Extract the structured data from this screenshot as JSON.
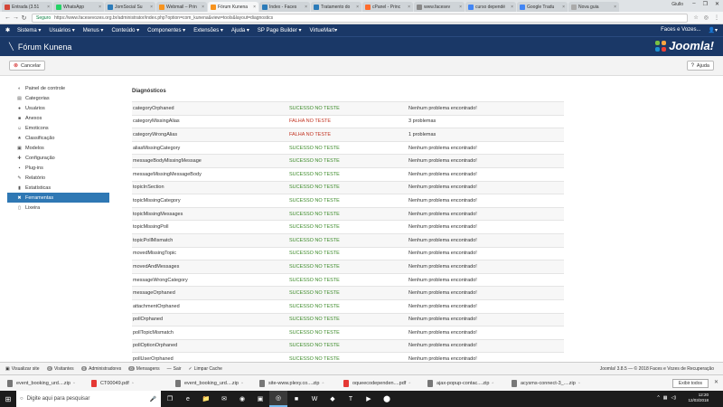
{
  "browser": {
    "tabs": [
      {
        "title": "Entrada (3.51",
        "color": "#d44638"
      },
      {
        "title": "WhatsApp",
        "color": "#25d366"
      },
      {
        "title": "JomSocial Su",
        "color": "#2b7bb9"
      },
      {
        "title": "Webmail – Prin",
        "color": "#f7931e"
      },
      {
        "title": "Fórum Kunena",
        "color": "#f7931e"
      },
      {
        "title": "Index - Faces",
        "color": "#2b7bb9"
      },
      {
        "title": "Tratamento do",
        "color": "#2b7bb9"
      },
      {
        "title": "cPanel - Princ",
        "color": "#ff6c2c"
      },
      {
        "title": "www.facesev",
        "color": "#888888"
      },
      {
        "title": "curso dependé",
        "color": "#4285f4"
      },
      {
        "title": "Google Tradu",
        "color": "#4285f4"
      },
      {
        "title": "Nova guia",
        "color": "#aaaaaa"
      }
    ],
    "active_tab": 4,
    "user": "Giullo",
    "secure_label": "Seguro",
    "url": "https://www.facesevozes.org.br/administrator/index.php?option=com_kunena&view=tools&layout=diagnostics"
  },
  "joomla_nav": {
    "menus": [
      "Sistema ▾",
      "Usuários ▾",
      "Menus ▾",
      "Conteúdo ▾",
      "Componentes ▾",
      "Extensões ▾",
      "Ajuda ▾",
      "SP Page Builder ▾",
      "VirtueMart▾"
    ],
    "site_name": "Faces e Vozes...",
    "user_menu": "▾"
  },
  "page": {
    "title": "Fórum Kunena",
    "logo_text": "Joomla!",
    "cancel_label": "Cancelar",
    "help_label": "Ajuda"
  },
  "sidebar": {
    "items": [
      {
        "label": "Painel de controle",
        "icon": "dashboard-icon",
        "glyph": "◐"
      },
      {
        "label": "Categorias",
        "icon": "categories-icon",
        "glyph": "▤"
      },
      {
        "label": "Usuários",
        "icon": "users-icon",
        "glyph": "●"
      },
      {
        "label": "Anexos",
        "icon": "attachments-icon",
        "glyph": "■"
      },
      {
        "label": "Emoticons",
        "icon": "emoticons-icon",
        "glyph": "☺"
      },
      {
        "label": "Classificação",
        "icon": "ranking-icon",
        "glyph": "★"
      },
      {
        "label": "Modelos",
        "icon": "templates-icon",
        "glyph": "▣"
      },
      {
        "label": "Configuração",
        "icon": "config-icon",
        "glyph": "✚"
      },
      {
        "label": "Plug-ins",
        "icon": "plugins-icon",
        "glyph": "▪"
      },
      {
        "label": "Relatório",
        "icon": "report-icon",
        "glyph": "✎"
      },
      {
        "label": "Estatísticas",
        "icon": "stats-icon",
        "glyph": "▮"
      },
      {
        "label": "Ferramentas",
        "icon": "tools-icon",
        "glyph": "✖"
      },
      {
        "label": "Lixeira",
        "icon": "trash-icon",
        "glyph": "▯"
      }
    ],
    "active_index": 11
  },
  "diagnostics": {
    "heading": "Diagnósticos",
    "rows": [
      {
        "name": "categoryOrphaned",
        "status": "SUCESSO NO TESTE",
        "ok": true,
        "result": "Nenhum problema encontrado!"
      },
      {
        "name": "categoryMissingAlias",
        "status": "FALHA NO TESTE",
        "ok": false,
        "result": "3 problemas"
      },
      {
        "name": "categoryWrongAlias",
        "status": "FALHA NO TESTE",
        "ok": false,
        "result": "1 problemas"
      },
      {
        "name": "aliasMissingCategory",
        "status": "SUCESSO NO TESTE",
        "ok": true,
        "result": "Nenhum problema encontrado!"
      },
      {
        "name": "messageBodyMissingMessage",
        "status": "SUCESSO NO TESTE",
        "ok": true,
        "result": "Nenhum problema encontrado!"
      },
      {
        "name": "messageMissingMessageBody",
        "status": "SUCESSO NO TESTE",
        "ok": true,
        "result": "Nenhum problema encontrado!"
      },
      {
        "name": "topicInSection",
        "status": "SUCESSO NO TESTE",
        "ok": true,
        "result": "Nenhum problema encontrado!"
      },
      {
        "name": "topicMissingCategory",
        "status": "SUCESSO NO TESTE",
        "ok": true,
        "result": "Nenhum problema encontrado!"
      },
      {
        "name": "topicMissingMessages",
        "status": "SUCESSO NO TESTE",
        "ok": true,
        "result": "Nenhum problema encontrado!"
      },
      {
        "name": "topicMissingPoll",
        "status": "SUCESSO NO TESTE",
        "ok": true,
        "result": "Nenhum problema encontrado!"
      },
      {
        "name": "topicPollMismatch",
        "status": "SUCESSO NO TESTE",
        "ok": true,
        "result": "Nenhum problema encontrado!"
      },
      {
        "name": "movedMissingTopic",
        "status": "SUCESSO NO TESTE",
        "ok": true,
        "result": "Nenhum problema encontrado!"
      },
      {
        "name": "movedAndMessages",
        "status": "SUCESSO NO TESTE",
        "ok": true,
        "result": "Nenhum problema encontrado!"
      },
      {
        "name": "messageWrongCategory",
        "status": "SUCESSO NO TESTE",
        "ok": true,
        "result": "Nenhum problema encontrado!"
      },
      {
        "name": "messageOrphaned",
        "status": "SUCESSO NO TESTE",
        "ok": true,
        "result": "Nenhum problema encontrado!"
      },
      {
        "name": "attachmentOrphaned",
        "status": "SUCESSO NO TESTE",
        "ok": true,
        "result": "Nenhum problema encontrado!"
      },
      {
        "name": "pollOrphaned",
        "status": "SUCESSO NO TESTE",
        "ok": true,
        "result": "Nenhum problema encontrado!"
      },
      {
        "name": "pollTopicMismatch",
        "status": "SUCESSO NO TESTE",
        "ok": true,
        "result": "Nenhum problema encontrado!"
      },
      {
        "name": "pollOptionOrphaned",
        "status": "SUCESSO NO TESTE",
        "ok": true,
        "result": "Nenhum problema encontrado!"
      },
      {
        "name": "pollUserOrphaned",
        "status": "SUCESSO NO TESTE",
        "ok": true,
        "result": "Nenhum problema encontrado!"
      }
    ]
  },
  "statusbar": {
    "view_site": "Visualizar site",
    "visitors_count": "0",
    "visitors_label": "Visitantes",
    "admins_count": "0",
    "admins_label": "Administradores",
    "messages_count": "0",
    "messages_label": "Mensagens",
    "logout": "Sair",
    "clear_cache": "Limpar Cache",
    "copyright": "Joomla! 3.8.5 — © 2018 Faces e Vozes de Recuperação"
  },
  "downloads": {
    "items": [
      {
        "name": "event_booking_urd....zip",
        "color": "#777777"
      },
      {
        "name": "CT00049.pdf",
        "color": "#e53935"
      },
      {
        "name": "event_booking_urd....zip",
        "color": "#777777"
      },
      {
        "name": "site-www.plexy.co....zip",
        "color": "#777777"
      },
      {
        "name": "oqueecodependen....pdf",
        "color": "#e53935"
      },
      {
        "name": "ajax-popup-contac....zip",
        "color": "#777777"
      },
      {
        "name": "acysms-connect-3_....zip",
        "color": "#777777"
      }
    ],
    "show_all": "Exibir todos"
  },
  "taskbar": {
    "search_placeholder": "Digite aqui para pesquisar",
    "apps": [
      "❐",
      "e",
      "📁",
      "✉",
      "◉",
      "▣",
      "◎",
      "■",
      "W",
      "◆",
      "T",
      "▶",
      "⬤"
    ],
    "active_app": 6,
    "time": "12:20",
    "date": "12/03/2018"
  }
}
